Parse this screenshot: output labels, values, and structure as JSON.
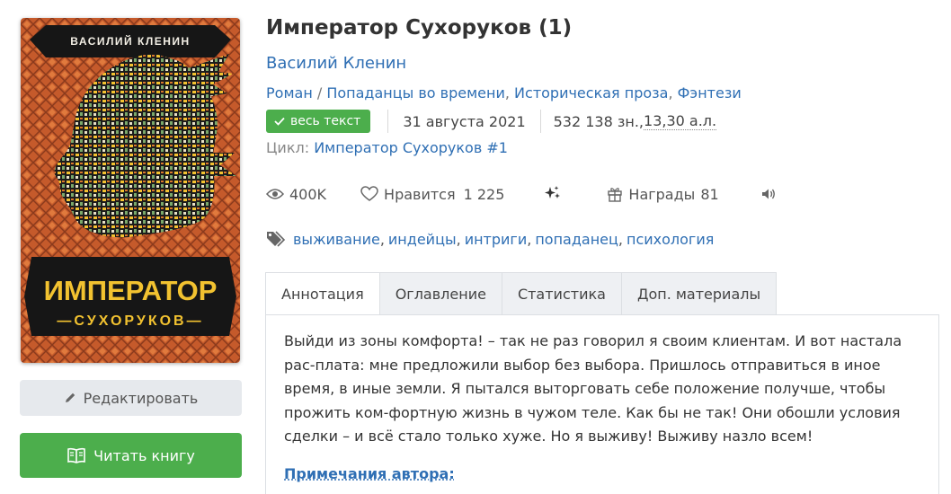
{
  "book": {
    "title": "Император Сухоруков (1)",
    "author": "Василий Кленин",
    "cover": {
      "author_text": "ВАСИЛИЙ КЛЕНИН",
      "title_text": "ИМПЕРАТОР",
      "subtitle_text": "—СУХОРУКОВ—"
    },
    "genres": [
      {
        "label": "Роман",
        "sep": " / "
      },
      {
        "label": "Попаданцы во времени",
        "sep": ", "
      },
      {
        "label": "Историческая проза",
        "sep": ", "
      },
      {
        "label": "Фэнтези",
        "sep": ""
      }
    ],
    "status_badge": "весь текст",
    "date": "31 августа 2021",
    "size_chars": "532 138 зн., ",
    "size_sheets": "13,30 а.л.",
    "cycle_label": "Цикл: ",
    "cycle_link": "Император Сухоруков #1"
  },
  "stats": {
    "views": "400K",
    "likes_label": "Нравится",
    "likes_count": "1 225",
    "awards_label": "Награды",
    "awards_count": "81"
  },
  "tags": [
    {
      "label": "выживание",
      "sep": ","
    },
    {
      "label": "индейцы",
      "sep": ","
    },
    {
      "label": "интриги",
      "sep": ","
    },
    {
      "label": "попаданец",
      "sep": ","
    },
    {
      "label": "психология",
      "sep": ""
    }
  ],
  "buttons": {
    "edit_label": "Редактировать",
    "read_label": "Читать книгу"
  },
  "tabs": [
    {
      "label": "Аннотация",
      "active": true
    },
    {
      "label": "Оглавление",
      "active": false
    },
    {
      "label": "Статистика",
      "active": false
    },
    {
      "label": "Доп. материалы",
      "active": false
    }
  ],
  "annotation": {
    "text": "Выйди из зоны комфорта! – так не раз говорил я своим клиентам. И вот настала рас-плата: мне предложили выбор без выбора. Пришлось отправиться в иное время, в иные земли. Я пытался выторговать себе положение получше, чтобы прожить ком-фортную жизнь в чужом теле. Как бы не так! Они обошли условия сделки – и всё стало только хуже. Но я выживу! Выживу назло всем!",
    "notes_title": "Примечания автора:"
  },
  "colors": {
    "link": "#2f6fb4",
    "success": "#4cae4c",
    "cover_orange": "#c0562a",
    "cover_gold": "#f2c230"
  },
  "icons": [
    "eye-icon",
    "heart-icon",
    "sparkles-icon",
    "gift-icon",
    "speaker-icon",
    "tag-icon",
    "pencil-icon",
    "book-icon",
    "check-icon"
  ]
}
